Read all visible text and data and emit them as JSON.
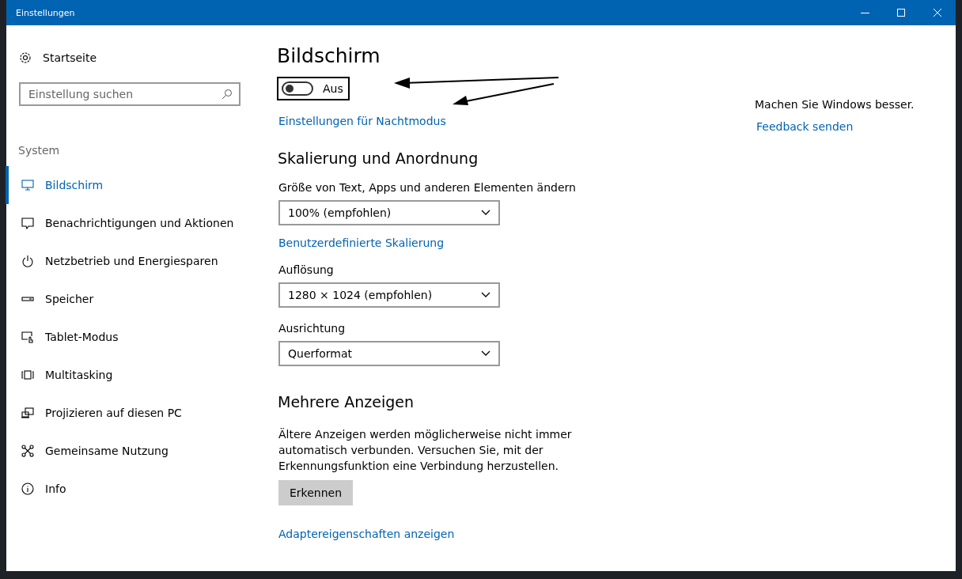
{
  "window": {
    "title": "Einstellungen"
  },
  "sidebar": {
    "home": "Startseite",
    "search": {
      "placeholder": "Einstellung suchen"
    },
    "section": "System",
    "items": [
      {
        "label": "Bildschirm",
        "selected": true
      },
      {
        "label": "Benachrichtigungen und Aktionen",
        "selected": false
      },
      {
        "label": "Netzbetrieb und Energiesparen",
        "selected": false
      },
      {
        "label": "Speicher",
        "selected": false
      },
      {
        "label": "Tablet-Modus",
        "selected": false
      },
      {
        "label": "Multitasking",
        "selected": false
      },
      {
        "label": "Projizieren auf diesen PC",
        "selected": false
      },
      {
        "label": "Gemeinsame Nutzung",
        "selected": false
      },
      {
        "label": "Info",
        "selected": false
      }
    ]
  },
  "main": {
    "title": "Bildschirm",
    "night_toggle": {
      "on": false,
      "label": "Aus"
    },
    "night_link": "Einstellungen für Nachtmodus",
    "scaling": {
      "heading": "Skalierung und Anordnung",
      "fields": [
        {
          "label": "Größe von Text, Apps und anderen Elementen ändern",
          "value": "100% (empfohlen)",
          "link": "Benutzerdefinierte Skalierung"
        },
        {
          "label": "Auflösung",
          "value": "1280 × 1024 (empfohlen)"
        },
        {
          "label": "Ausrichtung",
          "value": "Querformat"
        }
      ]
    },
    "multi": {
      "heading": "Mehrere Anzeigen",
      "text": "Ältere Anzeigen werden möglicherweise nicht immer automatisch verbunden. Versuchen Sie, mit der Erkennungsfunktion eine Verbindung herzustellen.",
      "button": "Erkennen",
      "link": "Adaptereigenschaften anzeigen"
    }
  },
  "aside": {
    "text": "Machen Sie Windows besser.",
    "link": "Feedback senden"
  }
}
